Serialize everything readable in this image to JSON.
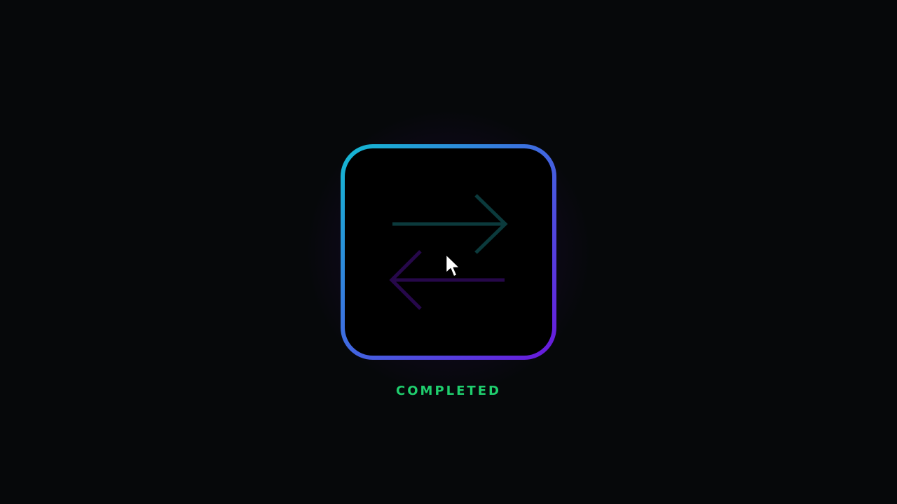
{
  "status": {
    "label": "COMPLETED",
    "color": "#1fce6e"
  },
  "tile": {
    "icon": "swap-arrows-icon",
    "gradient": [
      "#12bcd2",
      "#3d6ee0",
      "#6a16dc"
    ]
  },
  "arrows": {
    "right_color": "#0b3a3c",
    "left_color": "#26084a"
  },
  "cursor": {
    "icon": "mouse-pointer-icon"
  }
}
